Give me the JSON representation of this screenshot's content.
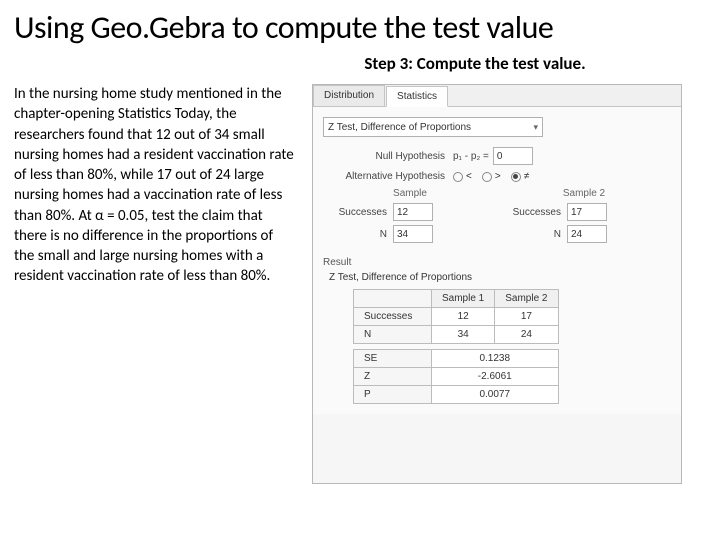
{
  "title": "Using Geo.Gebra to compute the test value",
  "subtitle": "Step 3: Compute the test value.",
  "paragraph": "In the nursing home study mentioned in the chapter-opening Statistics Today, the researchers found that 12 out of 34 small nursing homes had a resident vaccination rate of less than 80%, while 17 out of 24 large nursing homes had a vaccination rate of less than 80%. At α = 0.05, test the claim that there is no difference in the proportions of the small and large nursing homes with a resident vaccination rate of less than 80%.",
  "app": {
    "tabs": {
      "distribution": "Distribution",
      "statistics": "Statistics"
    },
    "dropdown": "Z Test, Difference of Proportions",
    "nullLabel": "Null Hypothesis",
    "nullExpr": "p₁ - p₂ =",
    "nullValue": "0",
    "altLabel": "Alternative Hypothesis",
    "altOptions": {
      "lt": "<",
      "gt": ">",
      "ne": "≠"
    },
    "altSelected": "ne",
    "sampleTitle": "Sample",
    "sample2Title": "Sample 2",
    "rowSuccesses": "Successes",
    "rowN": "N",
    "s1": {
      "succ": "12",
      "n": "34"
    },
    "s2": {
      "succ": "17",
      "n": "24"
    },
    "resultTitle": "Result",
    "resultSub": "Z Test, Difference of Proportions",
    "table": {
      "col1": "Sample 1",
      "col2": "Sample 2",
      "rows": {
        "succ": {
          "label": "Successes",
          "v1": "12",
          "v2": "17"
        },
        "n": {
          "label": "N",
          "v1": "34",
          "v2": "24"
        },
        "se": {
          "label": "SE",
          "v": "0.1238"
        },
        "z": {
          "label": "Z",
          "v": "-2.6061"
        },
        "p": {
          "label": "P",
          "v": "0.0077"
        }
      }
    }
  }
}
